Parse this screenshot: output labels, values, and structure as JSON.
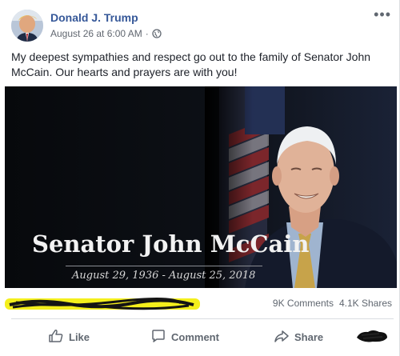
{
  "post": {
    "author": "Donald J. Trump",
    "timestamp": "August 26 at 6:00 AM",
    "separator": "·",
    "privacy_icon": "globe-icon",
    "more_label": "•••",
    "text": "My deepest sympathies and respect go out to the family of Senator John McCain. Our hearts and prayers are with you!"
  },
  "photo": {
    "title": "Senator John McCain",
    "dates": "August 29, 1936 - August 25, 2018"
  },
  "stats": {
    "comments": "9K Comments",
    "shares": "4.1K Shares"
  },
  "actions": {
    "like": "Like",
    "comment": "Comment",
    "share": "Share"
  },
  "colors": {
    "author_link": "#365899",
    "meta_text": "#616770",
    "action_text": "#606770",
    "photo_background": "#0a0c10",
    "scribble_highlight": "#f4ef1c"
  }
}
